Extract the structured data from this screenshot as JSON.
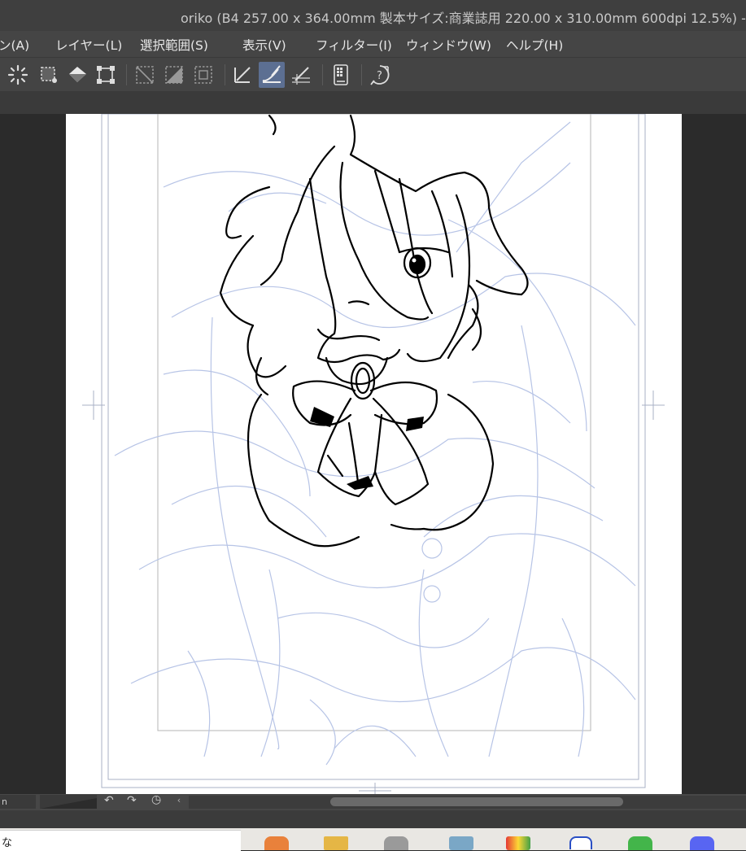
{
  "window": {
    "title": "oriko (B4 257.00 x 364.00mm 製本サイズ:商業誌用 220.00 x 310.00mm 600dpi 12.5%)  -"
  },
  "menu": {
    "items": [
      "ン(A)",
      "レイヤー(L)",
      "選択範囲(S)",
      "表示(V)",
      "フィルター(I)",
      "ウィンドウ(W)",
      "ヘルプ(H)"
    ]
  },
  "toolbar": {
    "icons": [
      "select-all-icon",
      "deselect-icon",
      "fill-icon",
      "transform-icon",
      "clear-icon",
      "fill-selection-icon",
      "invert-selection-icon",
      "ruler-snap-icon",
      "special-ruler-snap-icon",
      "grid-snap-icon",
      "device-icon",
      "help-icon"
    ],
    "active": "special-ruler-snap-icon"
  },
  "statusbar": {
    "zoom_value": "n"
  },
  "taskbar": {
    "search_text": "な"
  },
  "colors": {
    "accent": "#5c6f92",
    "sketch": "#b7c4e6",
    "lineart": "#000000"
  }
}
